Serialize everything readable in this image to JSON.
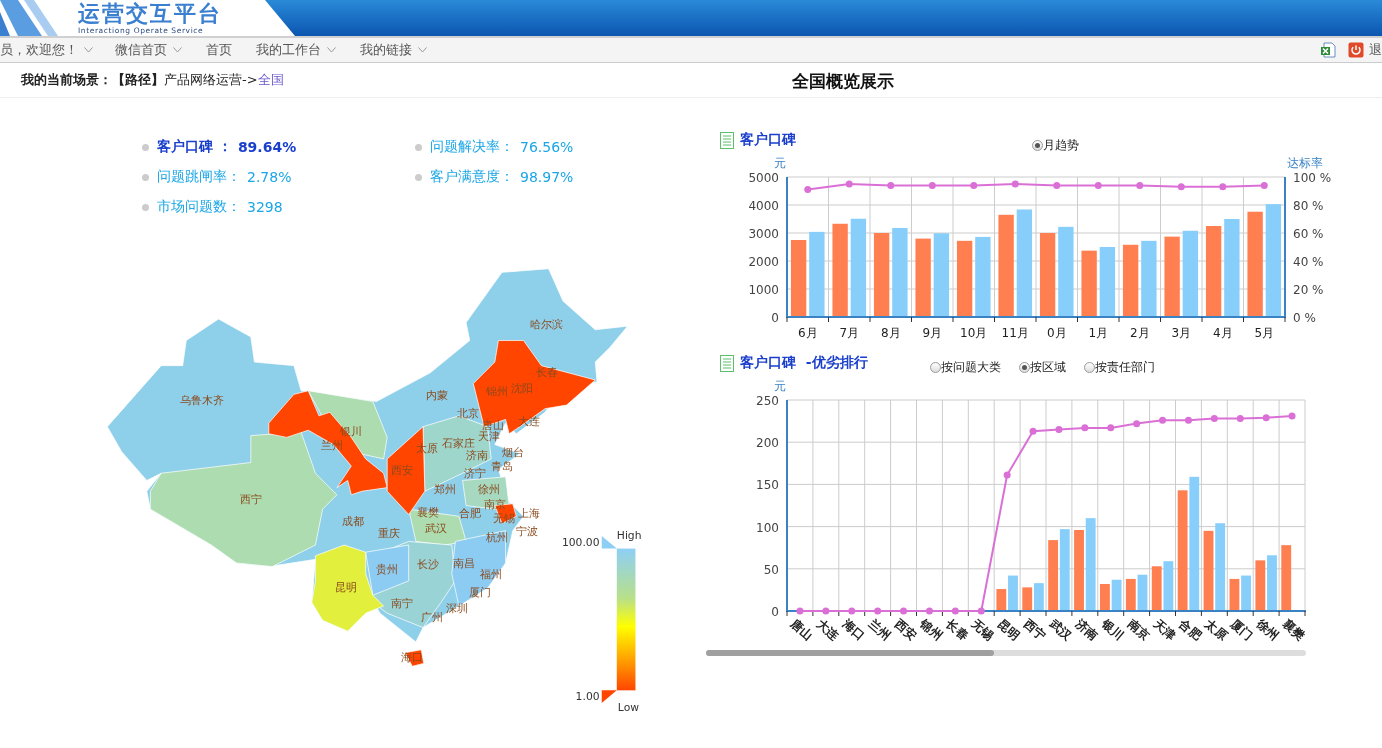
{
  "header": {
    "title": "运营交互平台",
    "subtitle": "Interactiong Operate Service"
  },
  "nav": {
    "items": [
      {
        "label": "员，欢迎您！",
        "dropdown": true
      },
      {
        "label": "微信首页",
        "dropdown": true
      },
      {
        "label": "首页",
        "dropdown": false
      },
      {
        "label": "我的工作台",
        "dropdown": true
      },
      {
        "label": "我的链接",
        "dropdown": true
      }
    ],
    "logout_label": "退"
  },
  "breadcrumb": {
    "text": "**我的当前场景：【路径】**产品网络运营->",
    "link": "全国"
  },
  "page_title": "全国概览展示",
  "kpis": [
    {
      "label": "客户口碑 ：",
      "value": "89.64%",
      "selected": true
    },
    {
      "label": "问题解决率：",
      "value": "76.56%",
      "selected": false
    },
    {
      "label": "问题跳闸率：",
      "value": "2.78%",
      "selected": false
    },
    {
      "label": "客户满意度：",
      "value": "98.97%",
      "selected": false
    },
    {
      "label": "市场问题数：",
      "value": "3298",
      "selected": false
    }
  ],
  "map": {
    "labels": [
      "哈尔滨",
      "长春",
      "锦州",
      "沈阳",
      "内蒙",
      "北京",
      "唐山",
      "大连",
      "乌鲁木齐",
      "银川",
      "兰州",
      "天津",
      "石家庄",
      "太原",
      "济南",
      "烟台",
      "青岛",
      "西安",
      "济宁",
      "郑州",
      "徐州",
      "西宁",
      "襄樊",
      "合肥",
      "南京",
      "无锡",
      "上海",
      "宁波",
      "成都",
      "武汉",
      "重庆",
      "杭州",
      "长沙",
      "南昌",
      "福州",
      "贵州",
      "昆明",
      "厦门",
      "南宁",
      "深圳",
      "广州",
      "海口"
    ],
    "legend": {
      "max": "100.00",
      "min": "1.00",
      "max_label": "High",
      "min_label": "Low"
    }
  },
  "panels": [
    {
      "title": "客户口碑",
      "options": [
        {
          "label": "月趋势",
          "selected": true
        }
      ],
      "chart_data": {
        "type": "bar",
        "ylabel": "元",
        "y2label": "达标率",
        "categories": [
          "6月",
          "7月",
          "8月",
          "9月",
          "10月",
          "11月",
          "0月",
          "1月",
          "2月",
          "3月",
          "4月",
          "5月"
        ],
        "ylim": [
          0,
          5000
        ],
        "yticks": [
          0,
          1000,
          2000,
          3000,
          4000,
          5000
        ],
        "y2lim": [
          0,
          100
        ],
        "y2ticks": [
          {
            "value": 0,
            "label": "0 %"
          },
          {
            "value": 20,
            "label": "20 %"
          },
          {
            "value": 40,
            "label": "40 %"
          },
          {
            "value": 60,
            "label": "60 %"
          },
          {
            "value": 80,
            "label": "80 %"
          },
          {
            "value": 100,
            "label": "100 %"
          }
        ],
        "series": [
          {
            "type": "bar",
            "color": "#ff7f50",
            "values": [
              2750,
              3330,
              3000,
              2800,
              2720,
              3650,
              3000,
              2370,
              2580,
              2870,
              3250,
              3760
            ]
          },
          {
            "type": "bar",
            "color": "#87cefa",
            "values": [
              3040,
              3510,
              3180,
              2990,
              2860,
              3840,
              3220,
              2500,
              2720,
              3080,
              3500,
              4030
            ]
          },
          {
            "type": "line",
            "axis": "y2",
            "marker": true,
            "color": "#da70d6",
            "values": [
              91,
              95,
              94,
              94,
              94,
              95,
              94,
              94,
              94,
              93,
              93,
              94
            ]
          }
        ],
        "grid": true
      }
    },
    {
      "title": "客户口碑  -优劣排行",
      "options": [
        {
          "label": "按问题大类",
          "selected": false
        },
        {
          "label": "按区域",
          "selected": true
        },
        {
          "label": "按责任部门",
          "selected": false
        }
      ],
      "chart_data": {
        "type": "bar",
        "ylabel": "元",
        "categories": [
          "唐山",
          "大连",
          "海口",
          "兰州",
          "西安",
          "锦州",
          "长春",
          "无锡",
          "昆明",
          "西宁",
          "武汉",
          "济南",
          "银川",
          "南京",
          "天津",
          "合肥",
          "太原",
          "厦门",
          "徐州",
          "襄樊"
        ],
        "ylim": [
          0,
          250
        ],
        "yticks": [
          0,
          50,
          100,
          150,
          200,
          250
        ],
        "series": [
          {
            "type": "bar",
            "color": "#ff7f50",
            "values": [
              0,
              0,
              0,
              0,
              0,
              0,
              0,
              0,
              26,
              28,
              84,
              96,
              32,
              38,
              53,
              143,
              95,
              38,
              60,
              78
            ]
          },
          {
            "type": "bar",
            "color": "#87cefa",
            "values": [
              0,
              0,
              0,
              0,
              0,
              0,
              0,
              0,
              42,
              33,
              97,
              110,
              37,
              43,
              59,
              159,
              104,
              42,
              66,
              null
            ]
          },
          {
            "type": "line",
            "marker": true,
            "color": "#da70d6",
            "values": [
              0,
              0,
              0,
              0,
              0,
              0,
              0,
              0,
              161,
              213,
              215,
              217,
              217,
              222,
              226,
              226,
              228,
              228,
              229,
              231
            ]
          }
        ],
        "grid": true
      }
    }
  ]
}
